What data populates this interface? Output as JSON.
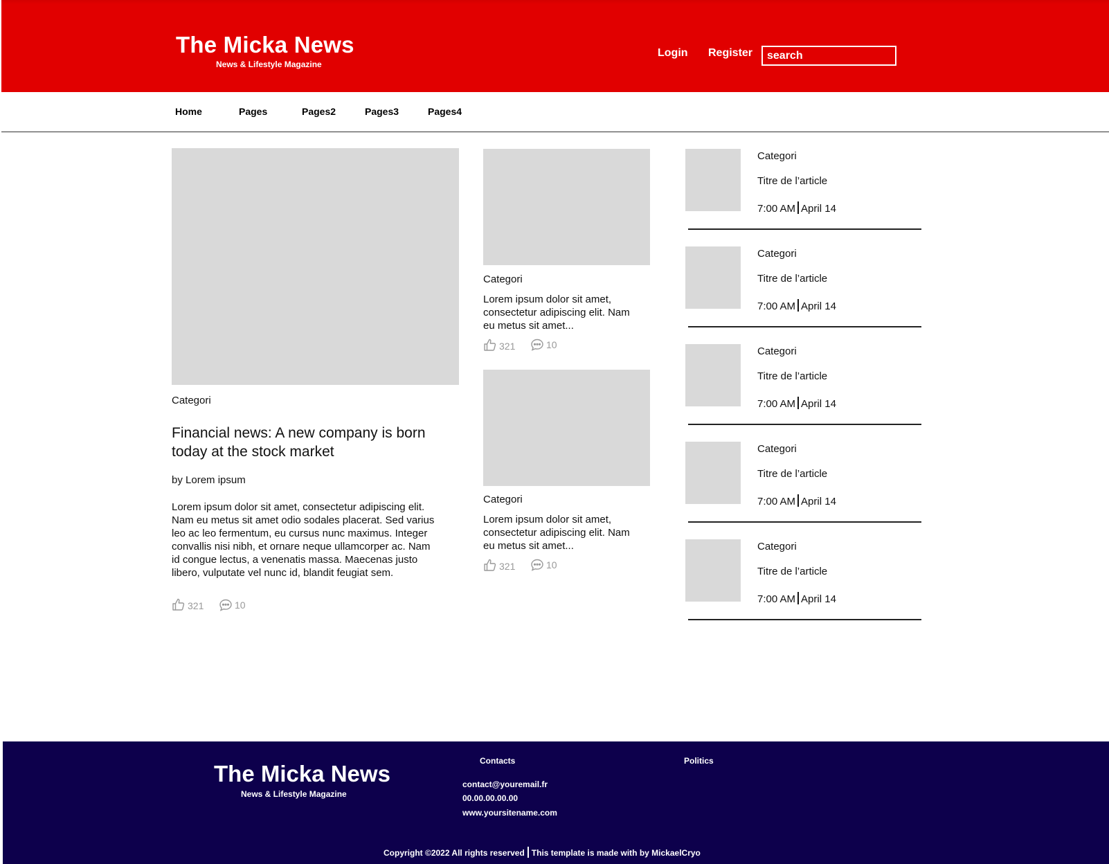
{
  "header": {
    "brand_title": "The Micka News",
    "brand_tagline": "News & Lifestyle Magazine",
    "login_label": "Login",
    "register_label": "Register",
    "search_placeholder": "search"
  },
  "nav": {
    "items": [
      {
        "label": "Home"
      },
      {
        "label": "Pages"
      },
      {
        "label": "Pages2"
      },
      {
        "label": "Pages3"
      },
      {
        "label": "Pages4"
      }
    ]
  },
  "featured": {
    "category": "Categori",
    "headline": "Financial news: A new company is born today at the stock market",
    "byline": "by Lorem ipsum",
    "body": "Lorem ipsum dolor sit amet, consectetur adipiscing elit. Nam eu metus sit amet odio sodales placerat. Sed varius leo ac leo fermentum, eu cursus nunc maximus. Integer convallis nisi nibh, et ornare neque ullamcorper ac. Nam id congue lectus, a venenatis massa. Maecenas justo libero, vulputate vel nunc id, blandit feugiat sem.",
    "likes": "321",
    "comments": "10"
  },
  "middle": [
    {
      "category": "Categori",
      "snippet": "Lorem ipsum dolor sit amet, consectetur adipiscing elit. Nam eu metus sit amet...",
      "likes": "321",
      "comments": "10"
    },
    {
      "category": "Categori",
      "snippet": "Lorem ipsum dolor sit amet, consectetur adipiscing elit. Nam eu metus sit amet...",
      "likes": "321",
      "comments": "10"
    }
  ],
  "sidebar": [
    {
      "category": "Categori",
      "title": "Titre de l’article",
      "time": "7:00 AM",
      "date": "April 14"
    },
    {
      "category": "Categori",
      "title": "Titre de l’article",
      "time": "7:00 AM",
      "date": "April 14"
    },
    {
      "category": "Categori",
      "title": "Titre de l’article",
      "time": "7:00 AM",
      "date": "April 14"
    },
    {
      "category": "Categori",
      "title": "Titre de l’article",
      "time": "7:00 AM",
      "date": "April 14"
    },
    {
      "category": "Categori",
      "title": "Titre de l’article",
      "time": "7:00 AM",
      "date": "April 14"
    }
  ],
  "footer": {
    "brand_title": "The Micka News",
    "brand_tagline": "News & Lifestyle Magazine",
    "contacts_heading": "Contacts",
    "email": "contact@youremail.fr",
    "phone": "00.00.00.00.00",
    "website": "www.yoursitename.com",
    "politics_heading": "Politics",
    "copyright": "Copyright ©2022 All rights reserved",
    "credit": "This template is made with  by MickaelCryo"
  },
  "colors": {
    "header_red": "#e10000",
    "footer_navy": "#0d004c",
    "placeholder_gray": "#d9d9d9",
    "stat_gray": "#999999"
  },
  "icons": {
    "like": "thumbs-up-icon",
    "comment": "comment-bubble-icon"
  }
}
